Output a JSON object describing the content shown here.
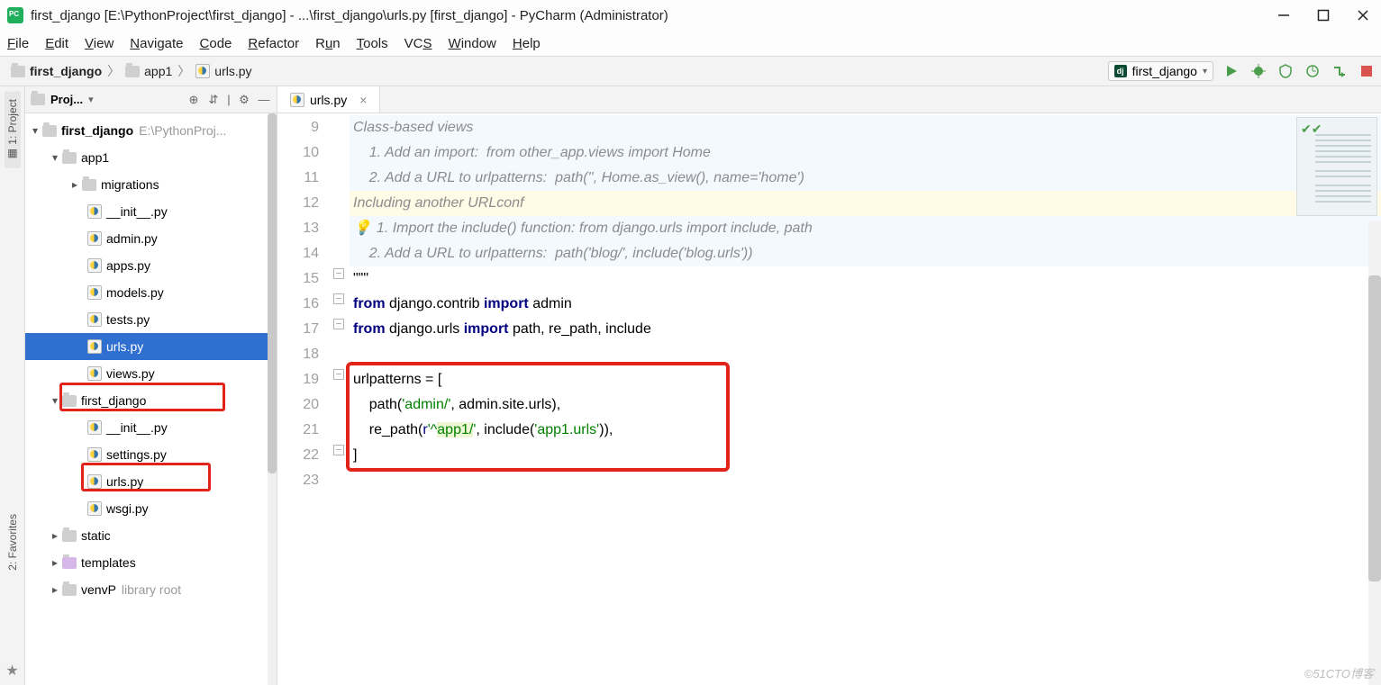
{
  "window": {
    "title": "first_django [E:\\PythonProject\\first_django] - ...\\first_django\\urls.py [first_django] - PyCharm (Administrator)"
  },
  "menu": {
    "file": "File",
    "edit": "Edit",
    "view": "View",
    "navigate": "Navigate",
    "code": "Code",
    "refactor": "Refactor",
    "run": "Run",
    "tools": "Tools",
    "vcs": "VCS",
    "window": "Window",
    "help": "Help"
  },
  "breadcrumbs": {
    "a": "first_django",
    "b": "app1",
    "c": "urls.py"
  },
  "run_config": {
    "label": "first_django"
  },
  "project_panel": {
    "title": "Proj...",
    "toggle": "▾"
  },
  "rail": {
    "project": "1: Project",
    "favorites": "2: Favorites"
  },
  "tree": {
    "root": "first_django",
    "root_path": "E:\\PythonProj...",
    "app1": "app1",
    "migrations": "migrations",
    "init": "__init__.py",
    "admin": "admin.py",
    "apps": "apps.py",
    "models": "models.py",
    "tests": "tests.py",
    "urls": "urls.py",
    "views": "views.py",
    "fd": "first_django",
    "init2": "__init__.py",
    "settings": "settings.py",
    "urls2": "urls.py",
    "wsgi": "wsgi.py",
    "static": "static",
    "templates": "templates",
    "venv": "venvP",
    "venv_tag": "library root"
  },
  "tab": {
    "name": "urls.py"
  },
  "lines": {
    "n9": "9",
    "n10": "10",
    "n11": "11",
    "n12": "12",
    "n13": "13",
    "n14": "14",
    "n15": "15",
    "n16": "16",
    "n17": "17",
    "n18": "18",
    "n19": "19",
    "n20": "20",
    "n21": "21",
    "n22": "22",
    "n23": "23"
  },
  "code": {
    "l9": "Class-based views",
    "l10": "    1. Add an import:  from other_app.views import Home",
    "l11": "    2. Add a URL to urlpatterns:  path('', Home.as_view(), name='home')",
    "l12": "Including another URLconf",
    "l13": "1. Import the include() function: from django.urls import include, path",
    "l14": "    2. Add a URL to urlpatterns:  path('blog/', include('blog.urls'))",
    "l15": "\"\"\"",
    "l16_a": "from",
    "l16_b": " django.contrib ",
    "l16_c": "import",
    "l16_d": " admin",
    "l17_a": "from",
    "l17_b": " django.urls ",
    "l17_c": "import",
    "l17_d": " path, re_path, include",
    "l19": "urlpatterns = [",
    "l20_a": "    path(",
    "l20_b": "'admin/'",
    "l20_c": ", admin.site.urls),",
    "l21_a": "    re_path(",
    "l21_b": "r",
    "l21_c": "'^",
    "l21_d": "app1/",
    "l21_e": "'",
    "l21_f": ", include(",
    "l21_g": "'app1.urls'",
    "l21_h": ")),",
    "l22": "]"
  },
  "watermark": "©51CTO博客"
}
